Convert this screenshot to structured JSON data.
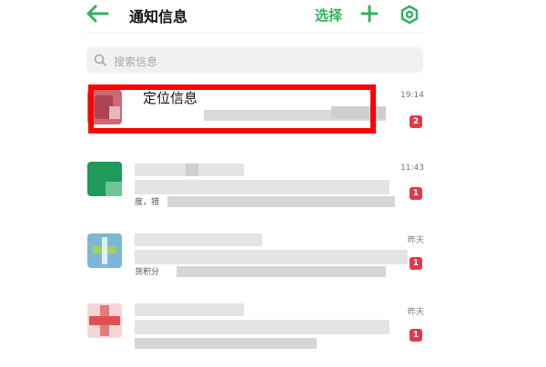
{
  "header": {
    "title": "通知信息",
    "select_label": "选择",
    "accent": "#31b35e"
  },
  "search": {
    "placeholder": "搜索信息"
  },
  "annotation": {
    "label": "定位信息",
    "color": "#ff0000"
  },
  "messages": [
    {
      "time": "19:14",
      "badge": "2",
      "preview_fragment": ""
    },
    {
      "time": "11:43",
      "badge": "1",
      "preview_fragment": "度，猎"
    },
    {
      "time": "昨天",
      "badge": "1",
      "preview_fragment": "货积分"
    },
    {
      "time": "昨天",
      "badge": "1",
      "preview_fragment": ""
    }
  ],
  "colors": {
    "badge": "#e13a46"
  }
}
